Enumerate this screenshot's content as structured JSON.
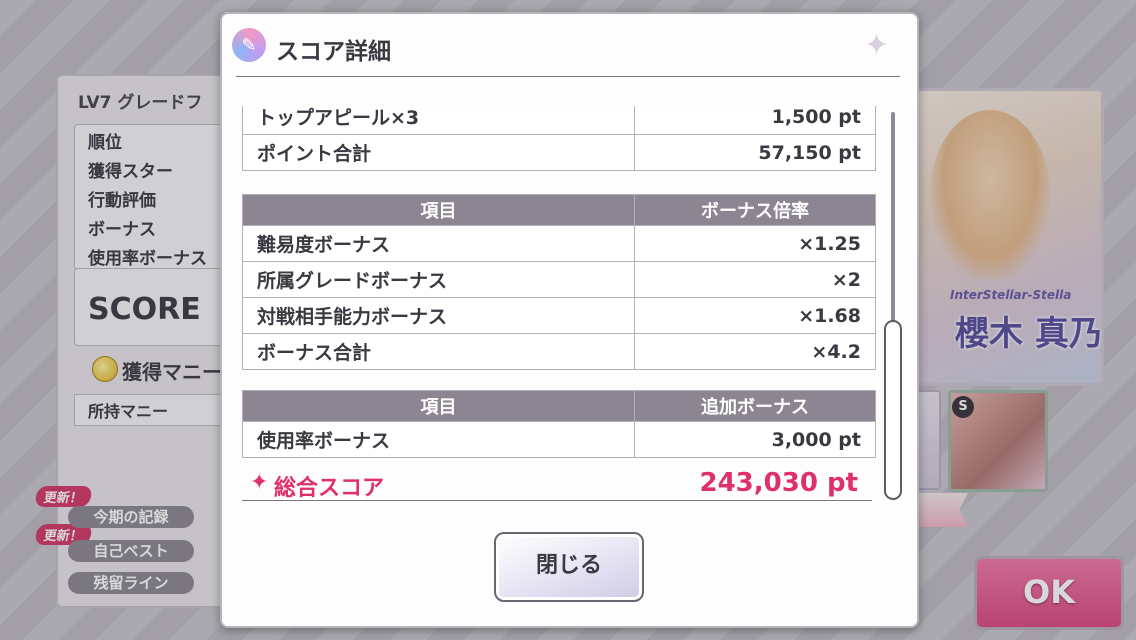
{
  "background": {
    "grade_title": "LV7 グレードフ",
    "stats": [
      "順位",
      "獲得スター",
      "行動評価",
      "ボーナス",
      "使用率ボーナス"
    ],
    "score_label": "SCORE",
    "money_title": "獲得マニー",
    "money_row": "所持マニー",
    "update_badge": "更新！",
    "buttons": [
      "今期の記録",
      "自己ベスト",
      "残留ライン"
    ],
    "card_subtitle": "InterStellar-Stella",
    "card_name": "櫻木 真乃",
    "rank_badge": "S",
    "ok_label": "OK"
  },
  "modal": {
    "title": "スコア詳細",
    "points_table": [
      {
        "label": "トップアピール×3",
        "value": "1,500 pt"
      },
      {
        "label": "ポイント合計",
        "value": "57,150 pt"
      }
    ],
    "bonus_table": {
      "headers": [
        "項目",
        "ボーナス倍率"
      ],
      "rows": [
        {
          "label": "難易度ボーナス",
          "value": "×1.25"
        },
        {
          "label": "所属グレードボーナス",
          "value": "×2"
        },
        {
          "label": "対戦相手能力ボーナス",
          "value": "×1.68"
        },
        {
          "label": "ボーナス合計",
          "value": "×4.2"
        }
      ]
    },
    "extra_table": {
      "headers": [
        "項目",
        "追加ボーナス"
      ],
      "rows": [
        {
          "label": "使用率ボーナス",
          "value": "3,000 pt"
        }
      ]
    },
    "total": {
      "label": "総合スコア",
      "value": "243,030 pt"
    },
    "close_label": "閉じる"
  },
  "colors": {
    "accent": "#e0306a",
    "header": "#8c8693",
    "ok": "#d94a82"
  }
}
